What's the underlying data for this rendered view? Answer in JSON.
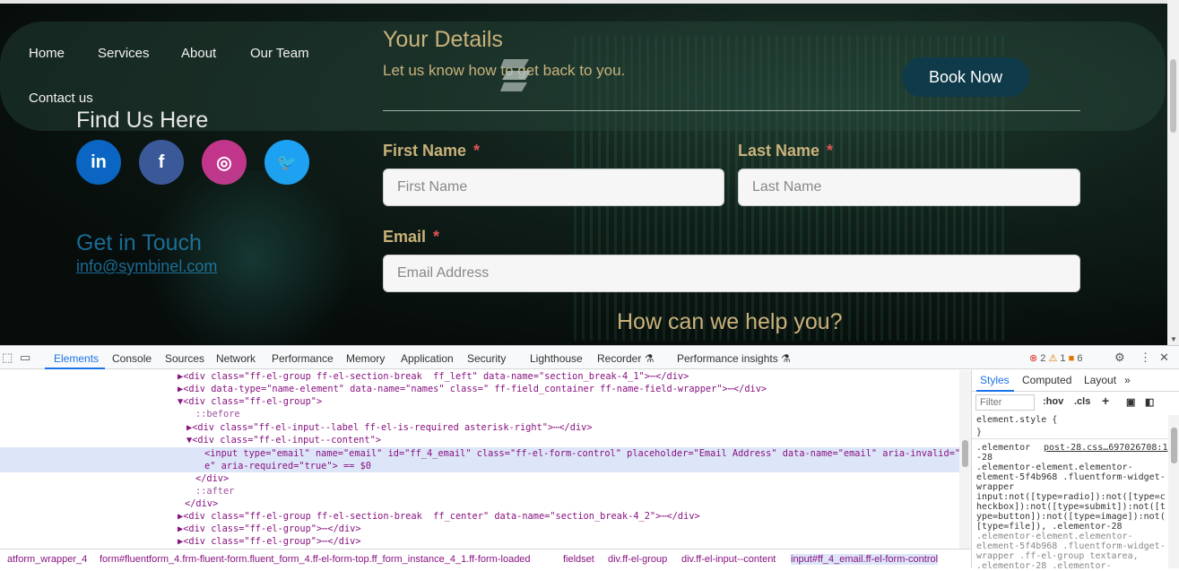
{
  "site": {
    "nav": [
      "Home",
      "Services",
      "About",
      "Our Team",
      "Contact us"
    ],
    "book_now": "Book Now",
    "find_us": "Find Us Here",
    "socials": [
      {
        "name": "LinkedIn",
        "glyph": "in",
        "color": "#0a66c2"
      },
      {
        "name": "Facebook",
        "glyph": "f",
        "color": "#3b5998"
      },
      {
        "name": "Instagram",
        "glyph": "◎",
        "color": "#c1358a"
      },
      {
        "name": "Twitter",
        "glyph": "🐦",
        "color": "#1da1f2"
      }
    ],
    "get_in_touch": "Get in Touch",
    "email_link": "info@symbinel.com",
    "form": {
      "title": "Your Details",
      "subtitle": "Let us know how to get back to you.",
      "first_name_label": "First Name",
      "last_name_label": "Last Name",
      "email_label": "Email",
      "required_mark": "*",
      "first_name_placeholder": "First Name",
      "last_name_placeholder": "Last Name",
      "email_placeholder": "Email Address",
      "help_heading": "How can we help you?"
    }
  },
  "devtools": {
    "tabs": [
      "Elements",
      "Console",
      "Sources",
      "Network",
      "Performance",
      "Memory",
      "Application",
      "Security",
      "Lighthouse",
      "Recorder ⚗",
      "Performance insights ⚗"
    ],
    "active_tab": "Elements",
    "counts": {
      "errors": "2",
      "warnings": "1",
      "info": "6"
    },
    "lines": [
      "▶<div class=\"ff-el-group ff-el-section-break  ff_left\" data-name=\"section_break-4_1\">⋯</div>",
      "▶<div data-type=\"name-element\" data-name=\"names\" class=\" ff-field_container ff-name-field-wrapper\">⋯</div>",
      "▼<div class=\"ff-el-group\">",
      "::before",
      "▶<div class=\"ff-el-input--label ff-el-is-required asterisk-right\">⋯</div>",
      "▼<div class=\"ff-el-input--content\">",
      "<input type=\"email\" name=\"email\" id=\"ff_4_email\" class=\"ff-el-form-control\" placeholder=\"Email Address\" data-name=\"email\" aria-invalid=\"fals",
      "e\" aria-required=\"true\"> == $0",
      "</div>",
      "::after",
      "</div>",
      "▶<div class=\"ff-el-group ff-el-section-break  ff_center\" data-name=\"section_break-4_2\">⋯</div>",
      "▶<div class=\"ff-el-group\">⋯</div>",
      "▶<div class=\"ff-el-group\">⋯</div>"
    ],
    "breadcrumbs": [
      "atform_wrapper_4",
      "form#fluentform_4.frm-fluent-form.fluent_form_4.ff-el-form-top.ff_form_instance_4_1.ff-form-loaded",
      "fieldset",
      "div.ff-el-group",
      "div.ff-el-input--content",
      "input#ff_4_email.ff-el-form-control"
    ],
    "styles": {
      "tabs": [
        "Styles",
        "Computed",
        "Layout"
      ],
      "filter_placeholder": "Filter",
      "hov": ":hov",
      "cls": ".cls",
      "element_style": "element.style {",
      "close_brace": "}",
      "rule_selector": ".elementor",
      "rule_source": "post-28.css…697026708:1",
      "rule_lines": [
        "-28",
        ".elementor-element.elementor-",
        "element-5f4b968 .fluentform-widget-",
        "wrapper",
        "input:not([type=radio]):not([type=c",
        "heckbox]):not([type=submit]):not([t",
        "ype=button]):not([type=image]):not(",
        "[type=file]), .elementor-28",
        ".elementor-element.elementor-",
        "element-5f4b968 .fluentform-widget-",
        "wrapper .ff-el-group textarea,",
        ".elementor-28 .elementor-"
      ]
    }
  }
}
